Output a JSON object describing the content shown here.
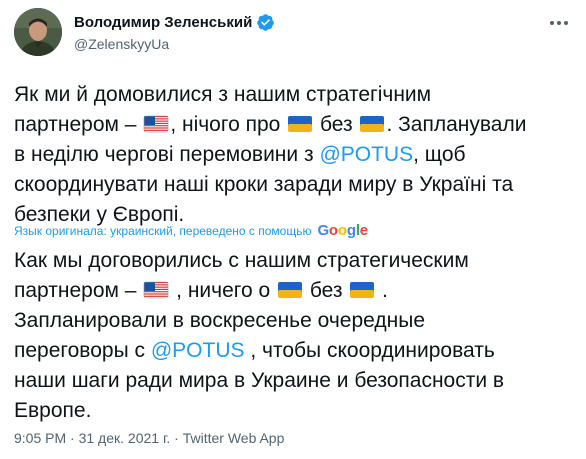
{
  "author": {
    "name": "Володимир Зеленський",
    "handle": "@ZelenskyyUa",
    "verified": true
  },
  "tweet": {
    "original_lines": [
      {
        "parts": [
          "Як ми й домовилися з нашим стратегічним"
        ]
      },
      {
        "parts": [
          "партнером – ",
          "flag-us",
          ", нічого про ",
          "flag-ua",
          " без ",
          "flag-ua",
          ". Запланували"
        ]
      },
      {
        "parts": [
          "в неділю чергові перемовини з ",
          "@POTUS",
          ", щоб"
        ]
      },
      {
        "parts": [
          "скоординувати наші кроки заради миру в Україні та"
        ]
      },
      {
        "parts": [
          "безпеки у Європі."
        ]
      }
    ],
    "translation_note": "Язык оригинала: украинский, переведено с помощью",
    "translation_provider": "Google",
    "translated_lines": [
      {
        "parts": [
          "Как мы договорились с нашим стратегическим"
        ]
      },
      {
        "parts": [
          "партнером – ",
          "flag-us",
          " , ничего о ",
          "flag-ua",
          " без ",
          "flag-ua",
          " ."
        ]
      },
      {
        "parts": [
          "Запланировали в воскресенье очередные"
        ]
      },
      {
        "parts": [
          "переговоры с ",
          "@POTUS",
          " , чтобы скоординировать"
        ]
      },
      {
        "parts": [
          "наши шаги ради мира в Украине и безопасности в"
        ]
      },
      {
        "parts": [
          "Европе."
        ]
      }
    ],
    "time": "9:05 PM",
    "date": "31 дек. 2021 г.",
    "source": "Twitter Web App",
    "separator": " · "
  },
  "icons": {
    "verified": "verified-badge-icon",
    "more": "more-options-icon",
    "flag_us": "us-flag-emoji",
    "flag_ua": "ukraine-flag-emoji"
  },
  "colors": {
    "link": "#1d9bf0",
    "text": "#0f1419",
    "secondary": "#536471"
  }
}
